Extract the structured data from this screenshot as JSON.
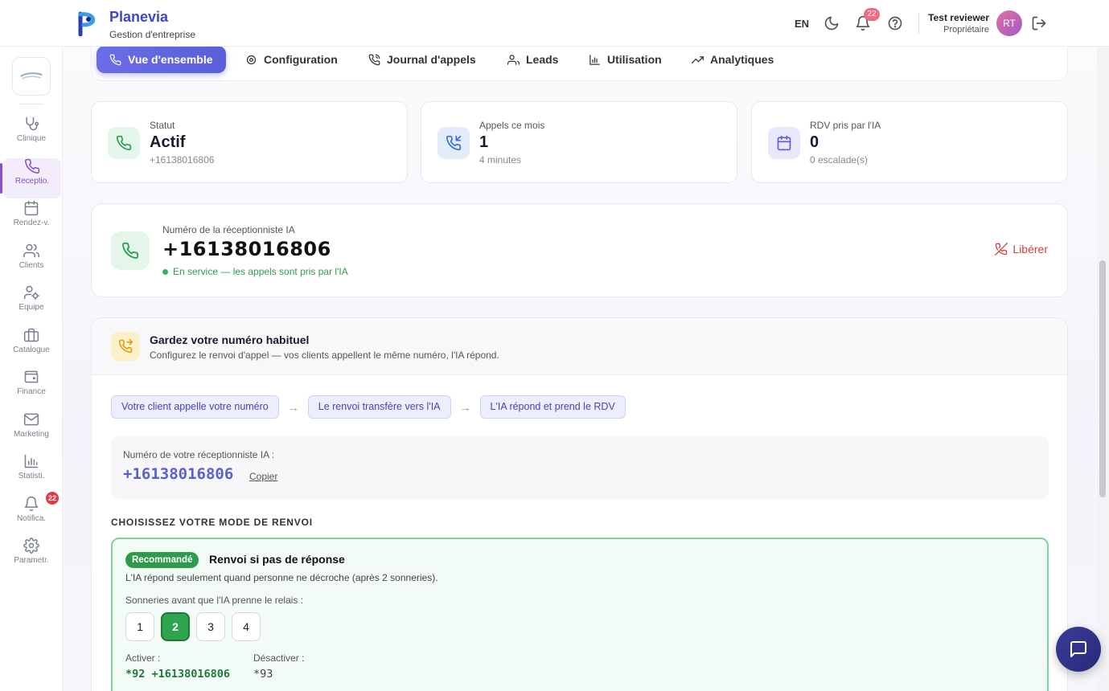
{
  "brand": {
    "name": "Planevia",
    "subtitle": "Gestion d'entreprise"
  },
  "header": {
    "language": "EN",
    "notifications_count": "22",
    "user_name": "Test reviewer",
    "user_role": "Propriétaire",
    "avatar_initials": "RT"
  },
  "sidebar": {
    "items": [
      {
        "label": "Clinique",
        "icon": "stethoscope-icon"
      },
      {
        "label": "Receptio.",
        "icon": "phone-icon"
      },
      {
        "label": "Rendez-v.",
        "icon": "calendar-icon"
      },
      {
        "label": "Clients",
        "icon": "users-icon"
      },
      {
        "label": "Equipe",
        "icon": "user-cog-icon"
      },
      {
        "label": "Catalogue",
        "icon": "briefcase-icon"
      },
      {
        "label": "Finance",
        "icon": "wallet-icon"
      },
      {
        "label": "Marketing",
        "icon": "mail-icon"
      },
      {
        "label": "Statisti.",
        "icon": "bar-chart-icon"
      },
      {
        "label": "Notifica.",
        "icon": "bell-icon"
      },
      {
        "label": "Parametr.",
        "icon": "gear-icon"
      }
    ],
    "notifications_badge": "22"
  },
  "tabs": [
    {
      "label": "Vue d'ensemble",
      "active": true
    },
    {
      "label": "Configuration"
    },
    {
      "label": "Journal d'appels"
    },
    {
      "label": "Leads"
    },
    {
      "label": "Utilisation"
    },
    {
      "label": "Analytiques"
    }
  ],
  "stats": [
    {
      "label": "Statut",
      "value": "Actif",
      "sub": "+16138016806"
    },
    {
      "label": "Appels ce mois",
      "value": "1",
      "sub": "4 minutes"
    },
    {
      "label": "RDV pris par l'IA",
      "value": "0",
      "sub": "0 escalade(s)"
    }
  ],
  "ai_number": {
    "label": "Numéro de la réceptionniste IA",
    "value": "+16138016806",
    "status": "En service — les appels sont pris par l'IA",
    "release_label": "Libérer"
  },
  "forwarding": {
    "title": "Gardez votre numéro habituel",
    "description": "Configurez le renvoi d'appel — vos clients appellent le même numéro, l'IA répond.",
    "flow": [
      "Votre client appelle votre numéro",
      "Le renvoi transfère vers l'IA",
      "L'IA répond et prend le RDV"
    ],
    "flow_arrow": "→",
    "ai_number_label": "Numéro de votre réceptionniste IA :",
    "ai_number_value": "+16138016806",
    "copy_label": "Copier",
    "mode_section_title": "CHOISISSEZ VOTRE MODE DE RENVOI",
    "mode": {
      "badge": "Recommandé",
      "name": "Renvoi si pas de réponse",
      "description": "L'IA répond seulement quand personne ne décroche (après 2 sonneries).",
      "rings_label": "Sonneries avant que l'IA prenne le relais :",
      "ring_options": [
        "1",
        "2",
        "3",
        "4"
      ],
      "selected_ring": "2",
      "activate_label": "Activer :",
      "activate_code": "*92 +16138016806",
      "deactivate_label": "Désactiver :",
      "deactivate_code": "*93"
    }
  },
  "colors": {
    "accent": "#5a5ed8",
    "active_sidebar": "#8a4fcf",
    "success": "#2e9a4c",
    "danger": "#d2413b"
  }
}
